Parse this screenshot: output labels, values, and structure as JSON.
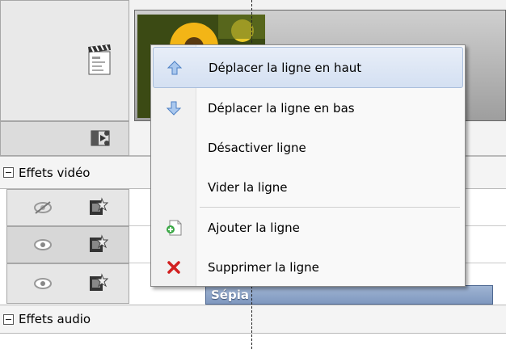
{
  "timeline": {
    "sections": {
      "video_effects": "Effets vidéo",
      "audio_effects": "Effets audio"
    },
    "clip_label": "Sépia"
  },
  "context_menu": {
    "items": [
      {
        "label": "Déplacer la ligne en haut",
        "icon": "arrow-up-icon"
      },
      {
        "label": "Déplacer la ligne en bas",
        "icon": "arrow-down-icon"
      },
      {
        "label": "Désactiver ligne",
        "icon": ""
      },
      {
        "label": "Vider la ligne",
        "icon": ""
      },
      {
        "label": "Ajouter la ligne",
        "icon": "add-line-icon"
      },
      {
        "label": "Supprimer la ligne",
        "icon": "delete-icon"
      }
    ]
  },
  "colors": {
    "menu_highlight": "#d4e0f2",
    "clip": "#8aa2c8",
    "delete_icon": "#d22020"
  }
}
